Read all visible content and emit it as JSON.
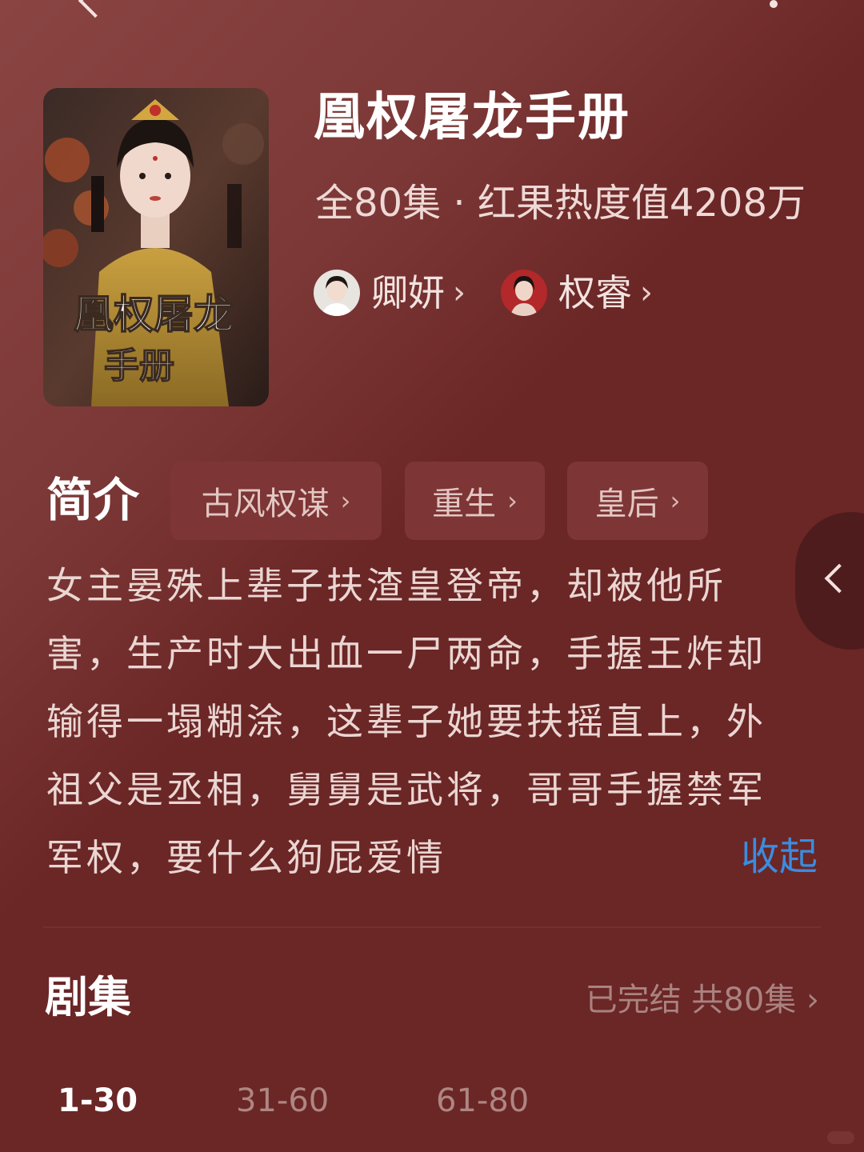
{
  "drama": {
    "title": "凰权屠龙手册",
    "meta": "全80集 · 红果热度值4208万",
    "poster_title_line1": "凰权屠龙",
    "poster_title_line2": "手册"
  },
  "cast": [
    {
      "name": "卿妍",
      "chevron": "›"
    },
    {
      "name": "权睿",
      "chevron": "›"
    }
  ],
  "intro": {
    "label": "简介",
    "tags": [
      {
        "label": "古风权谋",
        "chevron": "›"
      },
      {
        "label": "重生",
        "chevron": "›"
      },
      {
        "label": "皇后",
        "chevron": "›"
      }
    ],
    "lines": [
      "女主晏殊上辈子扶渣皇登帝，却被他所",
      "害，生产时大出血一尸两命，手握王炸却",
      "输得一塌糊涂，这辈子她要扶摇直上，外",
      "祖父是丞相，舅舅是武将，哥哥手握禁军",
      "军权，要什么狗屁爱情"
    ],
    "collapse": "收起"
  },
  "episodes": {
    "label": "剧集",
    "status": "已完结 共80集 ›",
    "ranges": [
      "1-30",
      "31-60",
      "61-80"
    ],
    "active_range": "1-30"
  },
  "icons": {
    "back": "chevron-left-icon",
    "more": "more-dots-icon",
    "side": "chevron-left-icon"
  },
  "colors": {
    "background": "#6b2626",
    "tag_background": "#7d3535",
    "link": "#3a8de0"
  }
}
